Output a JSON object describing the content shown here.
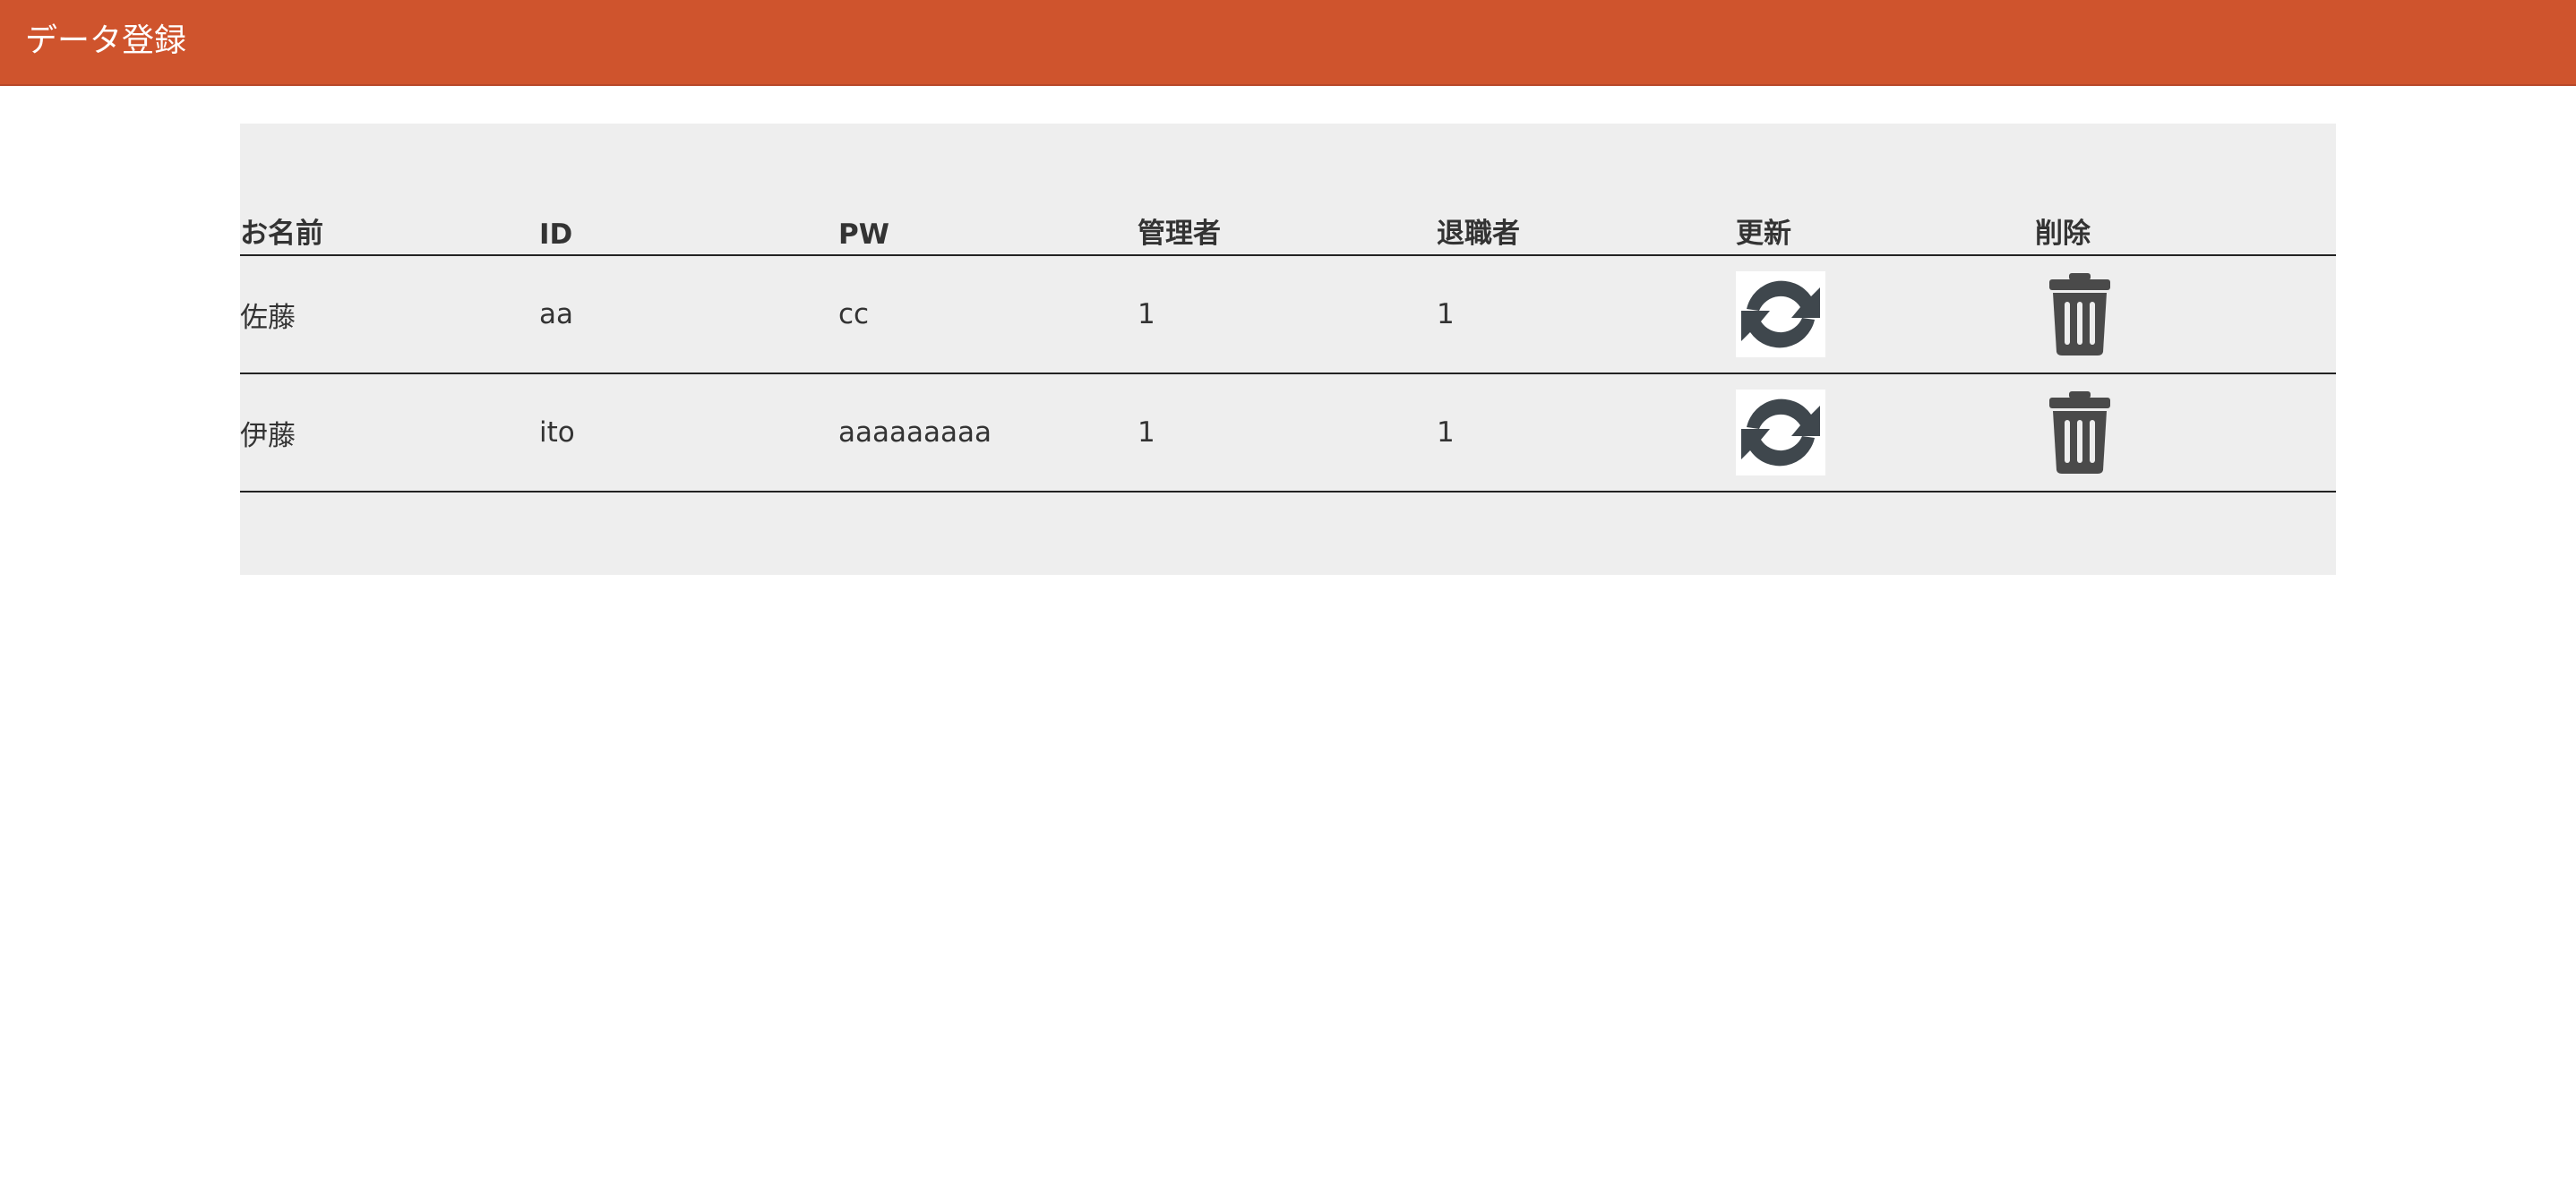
{
  "header": {
    "title": "データ登録"
  },
  "table": {
    "columns": [
      "お名前",
      "ID",
      "PW",
      "管理者",
      "退職者",
      "更新",
      "削除"
    ],
    "rows": [
      {
        "name": "佐藤",
        "id": "aa",
        "pw": "cc",
        "admin": "1",
        "retired": "1",
        "update_icon": "refresh-icon",
        "delete_icon": "trash-icon"
      },
      {
        "name": "伊藤",
        "id": "ito",
        "pw": "aaaaaaaaa",
        "admin": "1",
        "retired": "1",
        "update_icon": "refresh-icon",
        "delete_icon": "trash-icon"
      }
    ]
  },
  "colors": {
    "header_bg": "#cf542d",
    "panel_bg": "#eeeeee",
    "icon": "#3f474d"
  }
}
